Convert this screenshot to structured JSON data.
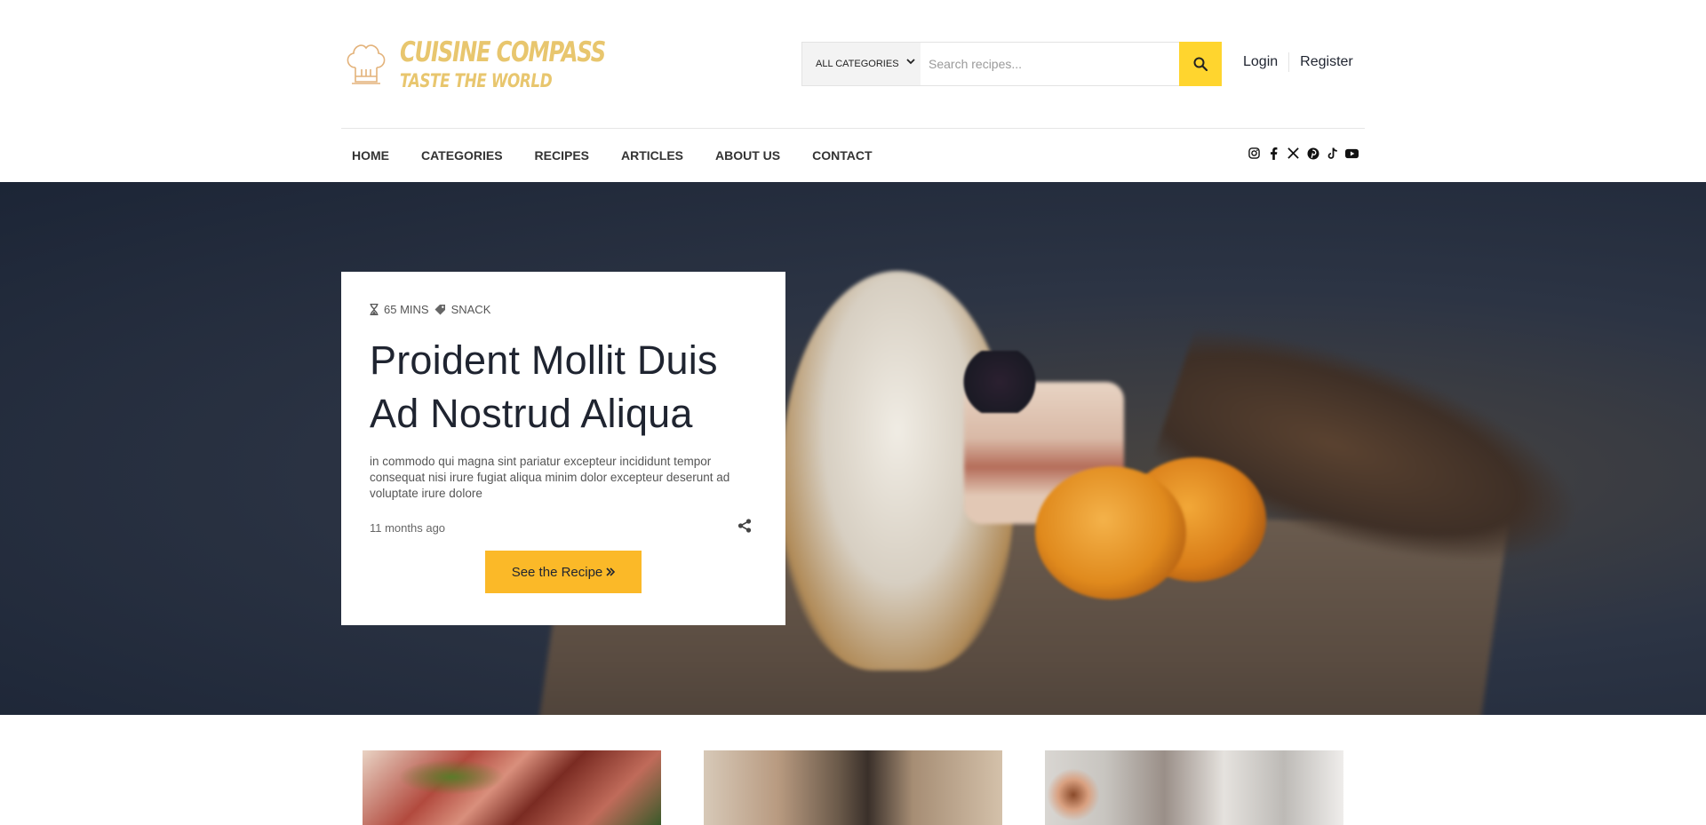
{
  "brand": {
    "name": "CUISINE COMPASS",
    "tagline": "TASTE THE WORLD",
    "color": "#e8c66e"
  },
  "search": {
    "category_selected": "ALL CATEGORIES",
    "placeholder": "Search recipes...",
    "button_color": "#ffd52e"
  },
  "auth": {
    "login": "Login",
    "register": "Register"
  },
  "nav": {
    "items": [
      "HOME",
      "CATEGORIES",
      "RECIPES",
      "ARTICLES",
      "ABOUT US",
      "CONTACT"
    ]
  },
  "social": [
    "instagram-icon",
    "facebook-icon",
    "x-icon",
    "pinterest-icon",
    "tiktok-icon",
    "youtube-icon"
  ],
  "hero": {
    "duration": "65 MINS",
    "category": "SNACK",
    "title": "Proident Mollit Duis Ad Nostrud Aliqua",
    "description": "in commodo qui magna sint pariatur excepteur incididunt tempor consequat nisi irure fugiat aliqua minim dolor excepteur deserunt ad voluptate irure dolore",
    "posted": "11 months ago",
    "cta": "See the Recipe",
    "cta_color": "#fbb928"
  }
}
